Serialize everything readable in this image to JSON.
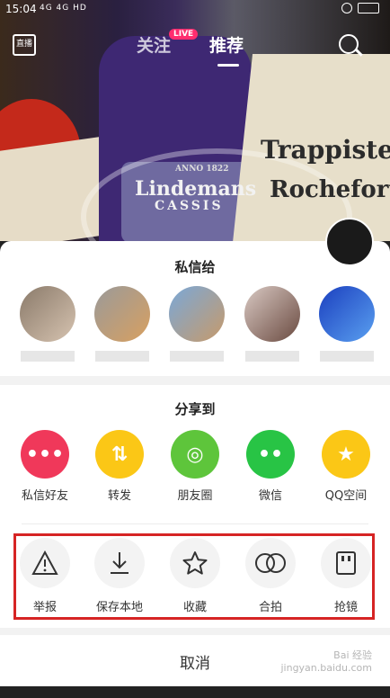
{
  "status_bar": {
    "time": "15:04",
    "signal": "4G 4G HD"
  },
  "top_nav": {
    "live_icon_label": "直播",
    "tabs": [
      {
        "label": "关注"
      },
      {
        "label": "推荐"
      }
    ],
    "live_badge": "LIVE"
  },
  "background_text": {
    "bottle1": "Lindemans",
    "bottle1_sub": "CASSIS",
    "bottle2": "Trappistes",
    "bottle2_sub": "Rochefort",
    "year": "ANNO 1822"
  },
  "dm_section": {
    "title": "私信给"
  },
  "share_section": {
    "title": "分享到",
    "items": [
      {
        "label": "私信好友",
        "icon": "message-icon",
        "color": "#f0385a"
      },
      {
        "label": "转发",
        "icon": "repost-icon",
        "color": "#fbc716"
      },
      {
        "label": "朋友圈",
        "icon": "moments-icon",
        "color": "#5ec53b"
      },
      {
        "label": "微信",
        "icon": "wechat-icon",
        "color": "#28c445"
      },
      {
        "label": "QQ空间",
        "icon": "qzone-icon",
        "color": "#fbc716"
      }
    ]
  },
  "actions": {
    "items": [
      {
        "label": "举报",
        "icon": "warning-icon"
      },
      {
        "label": "保存本地",
        "icon": "download-icon"
      },
      {
        "label": "收藏",
        "icon": "star-icon"
      },
      {
        "label": "合拍",
        "icon": "duet-icon"
      },
      {
        "label": "抢镜",
        "icon": "grab-icon"
      }
    ]
  },
  "cancel_label": "取消",
  "watermark": "Bai 经验\njingyan.baidu.com"
}
